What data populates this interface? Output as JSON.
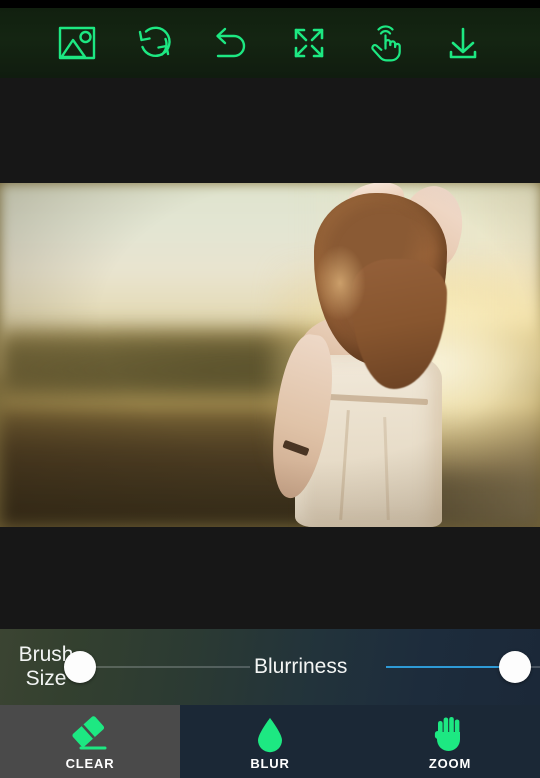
{
  "app": {
    "accent_green": "#1de882",
    "accent_blue": "#2e9ad6",
    "toolbar_bg": "#142512",
    "canvas_bg": "#171717",
    "panel_bg_left": "#3b4432",
    "panel_bg_right": "#1b2838",
    "tab_selected_bg": "#4a4a4a",
    "tab_bg": "#1b2836"
  },
  "toolbar": {
    "items": [
      {
        "name": "gallery-icon",
        "label": "Gallery"
      },
      {
        "name": "refresh-icon",
        "label": "Reset"
      },
      {
        "name": "undo-icon",
        "label": "Undo"
      },
      {
        "name": "fullscreen-icon",
        "label": "Fit to screen"
      },
      {
        "name": "touch-tap-icon",
        "label": "Touch mode"
      },
      {
        "name": "download-icon",
        "label": "Save"
      }
    ]
  },
  "canvas": {
    "photo_alt": "Woman with long wavy auburn hair in a cream dress standing in a sunlit field at sunset, seen from behind"
  },
  "sliders": {
    "brush_size": {
      "label": "Brush\nSize",
      "value": 0,
      "min": 0,
      "max": 100,
      "fill_percent": 0,
      "thumb_percent": 0
    },
    "blurriness": {
      "label": "Blurriness",
      "value": 84,
      "min": 0,
      "max": 100,
      "fill_percent": 84,
      "thumb_percent": 84
    }
  },
  "tabs": [
    {
      "label": "CLEAR",
      "icon": "eraser-icon",
      "selected": true
    },
    {
      "label": "BLUR",
      "icon": "water-drop-icon",
      "selected": false
    },
    {
      "label": "ZOOM",
      "icon": "hand-icon",
      "selected": false
    }
  ]
}
